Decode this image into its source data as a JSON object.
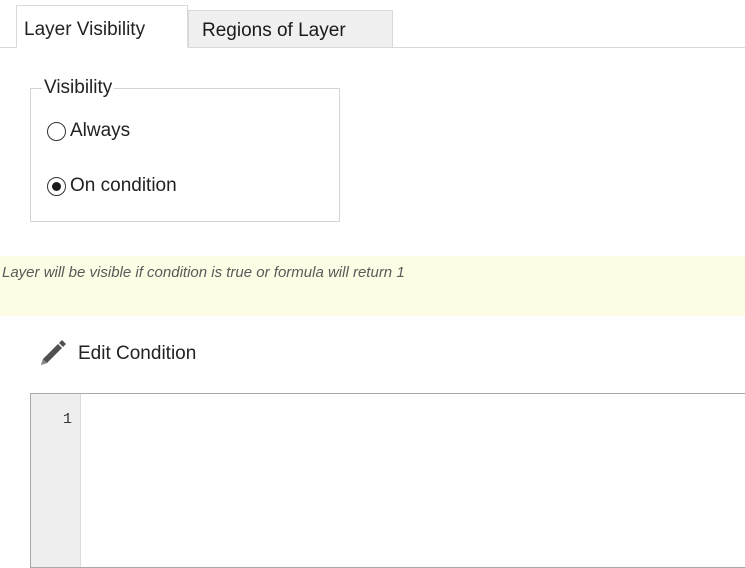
{
  "tabs": [
    {
      "label": "Layer Visibility",
      "active": true
    },
    {
      "label": "Regions of Layer",
      "active": false
    }
  ],
  "visibility_group": {
    "legend": "Visibility",
    "options": [
      {
        "label": "Always",
        "checked": false
      },
      {
        "label": "On condition",
        "checked": true
      }
    ]
  },
  "info_message": "Layer will be visible if condition is true or formula will return 1",
  "edit_condition": {
    "label": "Edit Condition",
    "icon": "pencil-icon"
  },
  "editor": {
    "line_numbers": [
      "1"
    ],
    "content": ""
  },
  "colors": {
    "info_background": "#fdfde5",
    "gutter_background": "#eeeeee"
  }
}
